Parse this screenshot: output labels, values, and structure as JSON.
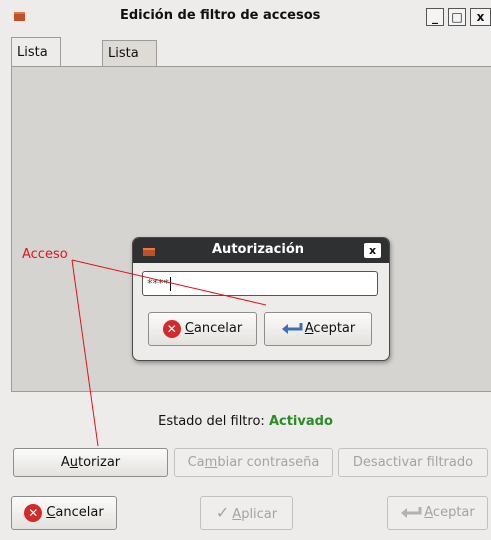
{
  "window": {
    "title": "Edición de filtro de accesos",
    "controls": {
      "minimize": "_",
      "maximize": "□",
      "close": "x"
    }
  },
  "tabs": [
    {
      "label": "Lista negra",
      "active": true
    },
    {
      "label": "Lista blanca",
      "active": false
    }
  ],
  "status": {
    "label": "Estado del filtro:",
    "value": "Activado",
    "value_color": "#2a8c25"
  },
  "actions": {
    "authorize_pre": "A",
    "authorize_mnemonic": "u",
    "authorize_post": "torizar",
    "change_pw_pre": "Ca",
    "change_pw_mnemonic": "m",
    "change_pw_post": "biar contraseña",
    "disable": "Desactivar filtrado"
  },
  "footer": {
    "cancel_mnemonic": "C",
    "cancel_rest": "ancelar",
    "apply_mnemonic": "A",
    "apply_rest": "plicar",
    "accept_mnemonic": "A",
    "accept_rest": "ceptar"
  },
  "dialog": {
    "title": "Autorización",
    "close": "x",
    "password_value": "****",
    "cancel_mnemonic": "C",
    "cancel_rest": "ancelar",
    "accept_mnemonic": "A",
    "accept_rest": "ceptar"
  },
  "annotation": {
    "label": "Acceso",
    "color": "#e0141b"
  },
  "icons": {
    "cancel": "cancel-circle-icon",
    "accept": "return-arrow-icon",
    "apply": "checkmark-icon",
    "app": "app-window-icon"
  }
}
